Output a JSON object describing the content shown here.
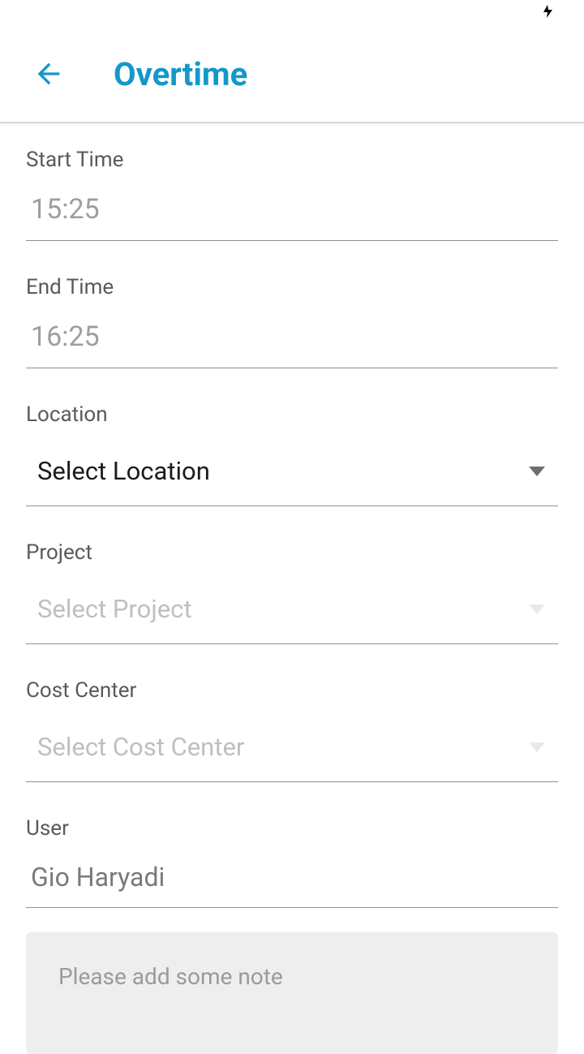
{
  "status": {
    "charging_icon": "⚡"
  },
  "header": {
    "title": "Overtime"
  },
  "form": {
    "start_time": {
      "label": "Start Time",
      "value": "15:25"
    },
    "end_time": {
      "label": "End Time",
      "value": "16:25"
    },
    "location": {
      "label": "Location",
      "placeholder": "Select Location"
    },
    "project": {
      "label": "Project",
      "placeholder": "Select Project"
    },
    "cost_center": {
      "label": "Cost Center",
      "placeholder": "Select Cost Center"
    },
    "user": {
      "label": "User",
      "value": "Gio Haryadi"
    },
    "note": {
      "placeholder": "Please add some note"
    }
  }
}
